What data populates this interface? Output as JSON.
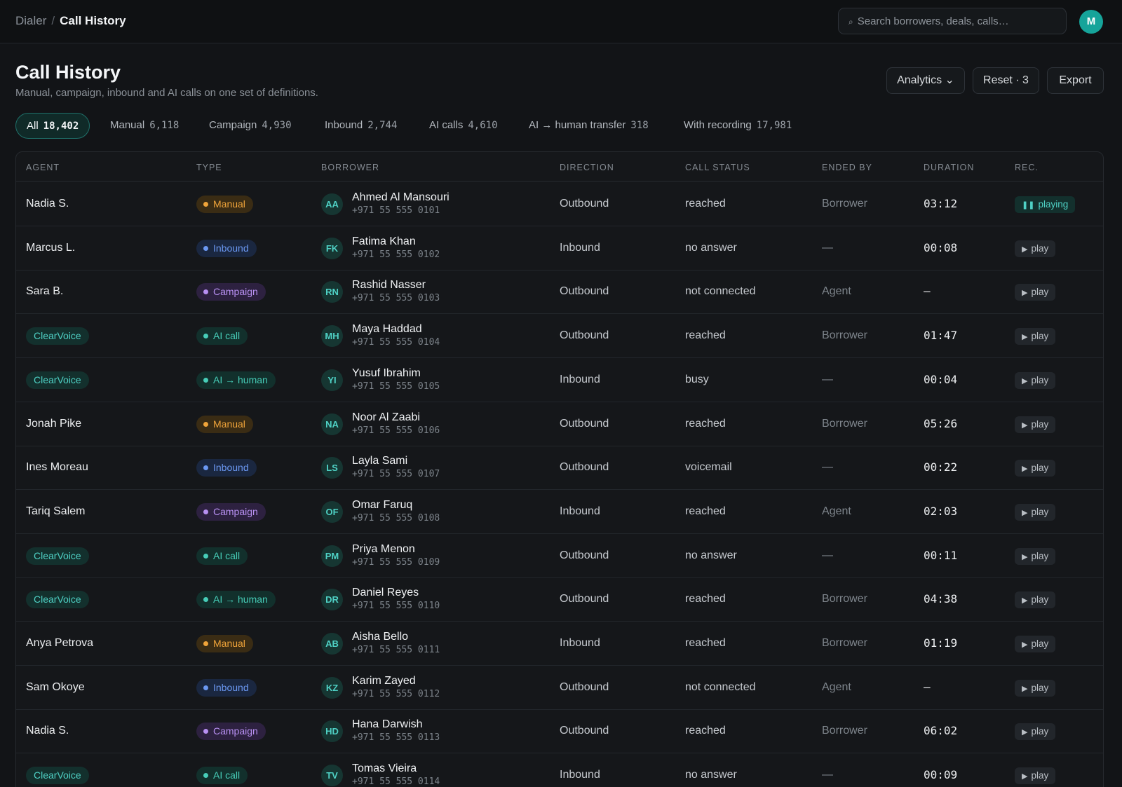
{
  "colors": {
    "accent": "#16a49a",
    "manual": "#f0a43a",
    "inbound": "#5b8cf0",
    "campaign": "#b07cf0",
    "ai": "#3ec7b0"
  },
  "topbar": {
    "breadcrumb_root": "Dialer",
    "breadcrumb_sep": "/",
    "breadcrumb_current": "Call History",
    "search_icon": "search-icon",
    "search_placeholder": "Search borrowers, deals, calls…",
    "avatar_initial": "M"
  },
  "header": {
    "title": "Call History",
    "subtitle": "Manual, campaign, inbound and AI calls on one set of definitions.",
    "analytics_label": "Analytics ⌄",
    "reset_label": "Reset · 3",
    "export_label": "Export"
  },
  "tabs": [
    {
      "label": "All",
      "count": "18,402"
    },
    {
      "label": "Manual",
      "count": "6,118"
    },
    {
      "label": "Campaign",
      "count": "4,930"
    },
    {
      "label": "Inbound",
      "count": "2,744"
    },
    {
      "label": "AI calls",
      "count": "4,610"
    },
    {
      "label": "AI → human transfer",
      "count": "318"
    },
    {
      "label": "With recording",
      "count": "17,981"
    }
  ],
  "columns": [
    "AGENT",
    "TYPE",
    "BORROWER",
    "DIRECTION",
    "CALL STATUS",
    "ENDED BY",
    "DURATION",
    "REC."
  ],
  "rows": [
    {
      "agent": "Nadia S.",
      "agent_chip": false,
      "type": "Manual",
      "type_key": "manual",
      "initials": "AA",
      "name": "Ahmed Al Mansouri",
      "phone": "+971 55 555 0101",
      "direction": "Outbound",
      "status": "reached",
      "ended_by": "Borrower",
      "duration": "03:12",
      "rec": "playing",
      "rec_glyph": "❚❚",
      "playing": true
    },
    {
      "agent": "Marcus L.",
      "agent_chip": false,
      "type": "Inbound",
      "type_key": "inbound",
      "initials": "FK",
      "name": "Fatima Khan",
      "phone": "+971 55 555 0102",
      "direction": "Inbound",
      "status": "no answer",
      "ended_by": "—",
      "duration": "00:08",
      "rec": "play",
      "rec_glyph": "▶",
      "playing": false
    },
    {
      "agent": "Sara B.",
      "agent_chip": false,
      "type": "Campaign",
      "type_key": "campaign",
      "initials": "RN",
      "name": "Rashid Nasser",
      "phone": "+971 55 555 0103",
      "direction": "Outbound",
      "status": "not connected",
      "ended_by": "Agent",
      "duration": "–",
      "rec": "play",
      "rec_glyph": "▶",
      "playing": false
    },
    {
      "agent": "ClearVoice",
      "agent_chip": true,
      "type": "AI call",
      "type_key": "ai",
      "initials": "MH",
      "name": "Maya Haddad",
      "phone": "+971 55 555 0104",
      "direction": "Outbound",
      "status": "reached",
      "ended_by": "Borrower",
      "duration": "01:47",
      "rec": "play",
      "rec_glyph": "▶",
      "playing": false
    },
    {
      "agent": "ClearVoice",
      "agent_chip": true,
      "type": "AI → human",
      "type_key": "ai",
      "initials": "YI",
      "name": "Yusuf Ibrahim",
      "phone": "+971 55 555 0105",
      "direction": "Inbound",
      "status": "busy",
      "ended_by": "—",
      "duration": "00:04",
      "rec": "play",
      "rec_glyph": "▶",
      "playing": false
    },
    {
      "agent": "Jonah Pike",
      "agent_chip": false,
      "type": "Manual",
      "type_key": "manual",
      "initials": "NA",
      "name": "Noor Al Zaabi",
      "phone": "+971 55 555 0106",
      "direction": "Outbound",
      "status": "reached",
      "ended_by": "Borrower",
      "duration": "05:26",
      "rec": "play",
      "rec_glyph": "▶",
      "playing": false
    },
    {
      "agent": "Ines Moreau",
      "agent_chip": false,
      "type": "Inbound",
      "type_key": "inbound",
      "initials": "LS",
      "name": "Layla Sami",
      "phone": "+971 55 555 0107",
      "direction": "Outbound",
      "status": "voicemail",
      "ended_by": "—",
      "duration": "00:22",
      "rec": "play",
      "rec_glyph": "▶",
      "playing": false
    },
    {
      "agent": "Tariq Salem",
      "agent_chip": false,
      "type": "Campaign",
      "type_key": "campaign",
      "initials": "OF",
      "name": "Omar Faruq",
      "phone": "+971 55 555 0108",
      "direction": "Inbound",
      "status": "reached",
      "ended_by": "Agent",
      "duration": "02:03",
      "rec": "play",
      "rec_glyph": "▶",
      "playing": false
    },
    {
      "agent": "ClearVoice",
      "agent_chip": true,
      "type": "AI call",
      "type_key": "ai",
      "initials": "PM",
      "name": "Priya Menon",
      "phone": "+971 55 555 0109",
      "direction": "Outbound",
      "status": "no answer",
      "ended_by": "—",
      "duration": "00:11",
      "rec": "play",
      "rec_glyph": "▶",
      "playing": false
    },
    {
      "agent": "ClearVoice",
      "agent_chip": true,
      "type": "AI → human",
      "type_key": "ai",
      "initials": "DR",
      "name": "Daniel Reyes",
      "phone": "+971 55 555 0110",
      "direction": "Outbound",
      "status": "reached",
      "ended_by": "Borrower",
      "duration": "04:38",
      "rec": "play",
      "rec_glyph": "▶",
      "playing": false
    },
    {
      "agent": "Anya Petrova",
      "agent_chip": false,
      "type": "Manual",
      "type_key": "manual",
      "initials": "AB",
      "name": "Aisha Bello",
      "phone": "+971 55 555 0111",
      "direction": "Inbound",
      "status": "reached",
      "ended_by": "Borrower",
      "duration": "01:19",
      "rec": "play",
      "rec_glyph": "▶",
      "playing": false
    },
    {
      "agent": "Sam Okoye",
      "agent_chip": false,
      "type": "Inbound",
      "type_key": "inbound",
      "initials": "KZ",
      "name": "Karim Zayed",
      "phone": "+971 55 555 0112",
      "direction": "Outbound",
      "status": "not connected",
      "ended_by": "Agent",
      "duration": "–",
      "rec": "play",
      "rec_glyph": "▶",
      "playing": false
    },
    {
      "agent": "Nadia S.",
      "agent_chip": false,
      "type": "Campaign",
      "type_key": "campaign",
      "initials": "HD",
      "name": "Hana Darwish",
      "phone": "+971 55 555 0113",
      "direction": "Outbound",
      "status": "reached",
      "ended_by": "Borrower",
      "duration": "06:02",
      "rec": "play",
      "rec_glyph": "▶",
      "playing": false
    },
    {
      "agent": "ClearVoice",
      "agent_chip": true,
      "type": "AI call",
      "type_key": "ai",
      "initials": "TV",
      "name": "Tomas Vieira",
      "phone": "+971 55 555 0114",
      "direction": "Inbound",
      "status": "no answer",
      "ended_by": "—",
      "duration": "00:09",
      "rec": "play",
      "rec_glyph": "▶",
      "playing": false
    }
  ]
}
